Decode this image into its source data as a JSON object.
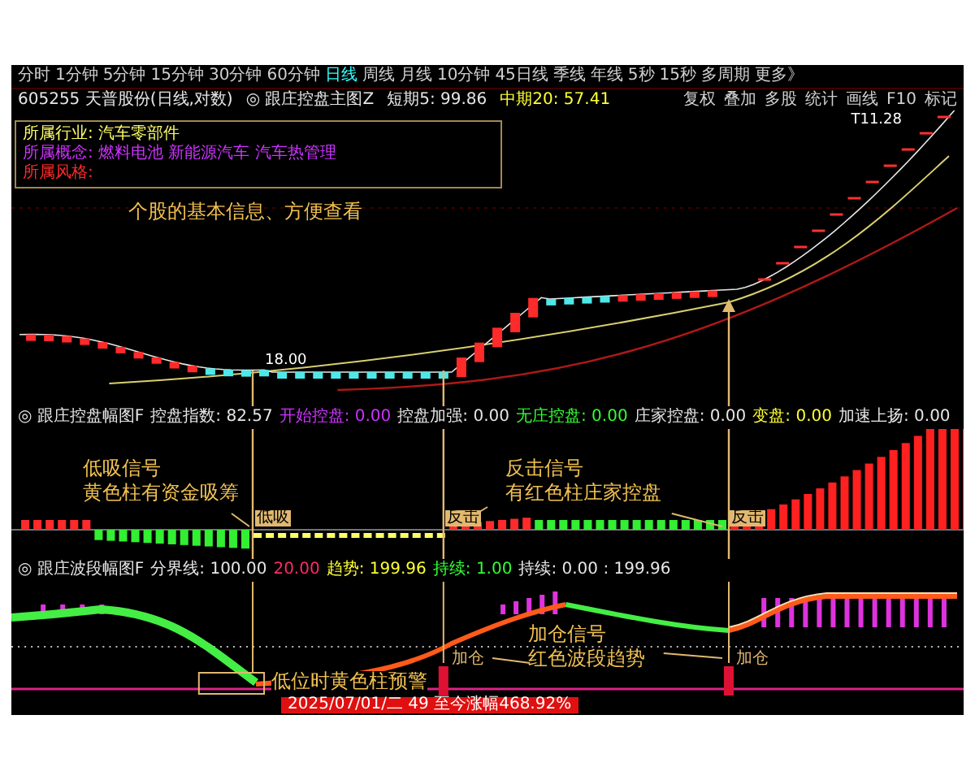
{
  "toolbar": {
    "periods": [
      {
        "label": "分时",
        "selected": false
      },
      {
        "label": "1分钟",
        "selected": false
      },
      {
        "label": "5分钟",
        "selected": false
      },
      {
        "label": "15分钟",
        "selected": false
      },
      {
        "label": "30分钟",
        "selected": false
      },
      {
        "label": "60分钟",
        "selected": false
      },
      {
        "label": "日线",
        "selected": true
      },
      {
        "label": "周线",
        "selected": false
      },
      {
        "label": "月线",
        "selected": false
      },
      {
        "label": "10分钟",
        "selected": false
      },
      {
        "label": "45日线",
        "selected": false
      },
      {
        "label": "季线",
        "selected": false
      },
      {
        "label": "年线",
        "selected": false
      },
      {
        "label": "5秒",
        "selected": false
      },
      {
        "label": "15秒",
        "selected": false
      },
      {
        "label": "多周期",
        "selected": false
      },
      {
        "label": "更多》",
        "selected": false
      }
    ],
    "tools": [
      "复权",
      "叠加",
      "多股",
      "统计",
      "画线",
      "F10",
      "标记"
    ]
  },
  "info_line": {
    "stock": "605255 天普股份(日线,对数)",
    "indicator": "◎ 跟庄控盘主图Z",
    "values": [
      {
        "text": "短期5: 99.86",
        "color": "#e6e6e6"
      },
      {
        "text": "中期20: 57.41",
        "color": "#ffff33"
      }
    ]
  },
  "info_box": {
    "lines": [
      {
        "text": "所属行业: 汽车零部件",
        "color": "#ffff66"
      },
      {
        "text": "所属概念: 燃料电池 新能源汽车 汽车热管理",
        "color": "#cc33ff"
      },
      {
        "text": "所属风格:",
        "color": "#ff2a2a"
      }
    ]
  },
  "main_chart": {
    "note": "个股的基本信息、方便查看",
    "high_label": "T11.28",
    "low_label": "18.00"
  },
  "control_pane": {
    "header": [
      {
        "text": "◎ 跟庄控盘幅图F",
        "color": "#e6e6e6"
      },
      {
        "text": "控盘指数: 82.57",
        "color": "#e6e6e6"
      },
      {
        "text": "开始控盘: 0.00",
        "color": "#cc33ff"
      },
      {
        "text": "控盘加强: 0.00",
        "color": "#e6e6e6"
      },
      {
        "text": "无庄控盘: 0.00",
        "color": "#33ff33"
      },
      {
        "text": "庄家控盘: 0.00",
        "color": "#e6e6e6"
      },
      {
        "text": "变盘: 0.00",
        "color": "#ffff33"
      },
      {
        "text": "加速上扬: 0.00",
        "color": "#e6e6e6"
      }
    ],
    "signals": [
      {
        "text": "低吸"
      },
      {
        "text": "反击"
      },
      {
        "text": "反击"
      }
    ],
    "notes": [
      {
        "title": "低吸信号",
        "detail": "黄色柱有资金吸筹"
      },
      {
        "title": "反击信号",
        "detail": "有红色柱庄家控盘"
      }
    ]
  },
  "wave_pane": {
    "header": [
      {
        "text": "◎ 跟庄波段幅图F",
        "color": "#e6e6e6"
      },
      {
        "text": "分界线: 100.00",
        "color": "#e6e6e6"
      },
      {
        "text": "20.00",
        "color": "#ff2a6a"
      },
      {
        "text": "趋势: 199.96",
        "color": "#ffff33"
      },
      {
        "text": "持续: 1.00",
        "color": "#33ff33"
      },
      {
        "text": "持续: 0.00 : 199.96",
        "color": "#e6e6e6"
      }
    ],
    "signals": [
      {
        "text": "加仓"
      },
      {
        "text": "加仓"
      }
    ],
    "notes": [
      {
        "title": "加仓信号",
        "detail": "红色波段趋势"
      },
      {
        "title": "低位时黄色柱预警"
      }
    ]
  },
  "status": {
    "text": "2025/07/01/二 49 至今涨幅468.92%"
  }
}
